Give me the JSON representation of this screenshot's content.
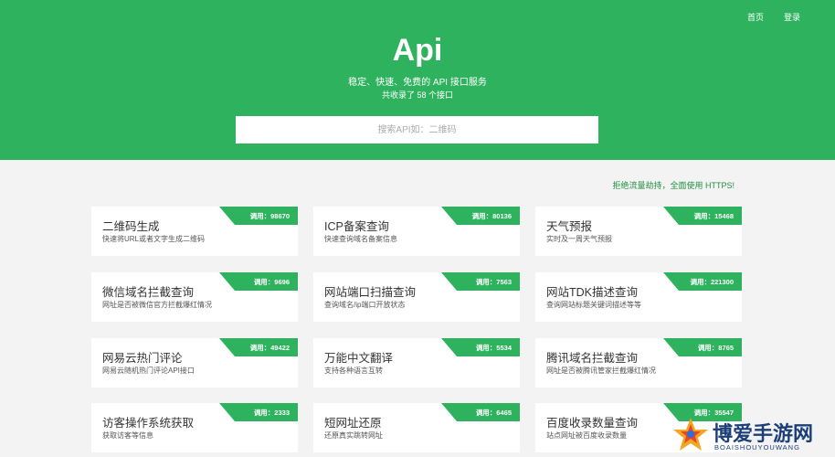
{
  "nav": {
    "home": "首页",
    "login": "登录"
  },
  "hero": {
    "title": "Api",
    "subtitle": "稳定、快速、免费的 API 接口服务",
    "count": "共收录了 58 个接口"
  },
  "search": {
    "placeholder": "搜索API如：二维码"
  },
  "notice": "拒绝流量劫持，全面使用 HTTPS!",
  "apis": [
    {
      "name": "二维码生成",
      "desc": "快速将URL或者文字生成二维码",
      "calls": "调用：98670"
    },
    {
      "name": "ICP备案查询",
      "desc": "快速查询域名备案信息",
      "calls": "调用：80136"
    },
    {
      "name": "天气预报",
      "desc": "实时及一周天气预报",
      "calls": "调用：15468"
    },
    {
      "name": "微信域名拦截查询",
      "desc": "网址是否被微信官方拦截爆红情况",
      "calls": "调用：9696"
    },
    {
      "name": "网站端口扫描查询",
      "desc": "查询域名/ip端口开放状态",
      "calls": "调用：7563"
    },
    {
      "name": "网站TDK描述查询",
      "desc": "查询网站标题关键词描述等等",
      "calls": "调用：221300"
    },
    {
      "name": "网易云热门评论",
      "desc": "网易云随机热门评论API接口",
      "calls": "调用：49422"
    },
    {
      "name": "万能中文翻译",
      "desc": "支持各种语言互转",
      "calls": "调用：5534"
    },
    {
      "name": "腾讯域名拦截查询",
      "desc": "网址是否被腾讯管家拦截爆红情况",
      "calls": "调用：8765"
    },
    {
      "name": "访客操作系统获取",
      "desc": "获取访客等信息",
      "calls": "调用：2333"
    },
    {
      "name": "短网址还原",
      "desc": "还原真实跳转网址",
      "calls": "调用：6465"
    },
    {
      "name": "百度收录数量查询",
      "desc": "站点网址被百度收录数量",
      "calls": "调用：35547"
    }
  ],
  "watermark": {
    "title": "博爱手游网",
    "subtitle": "BOAISHOUYOUWANG"
  },
  "colors": {
    "brand": "#2eb25e",
    "notice": "#1f8f3f",
    "watermark": "#1c3f7a"
  }
}
